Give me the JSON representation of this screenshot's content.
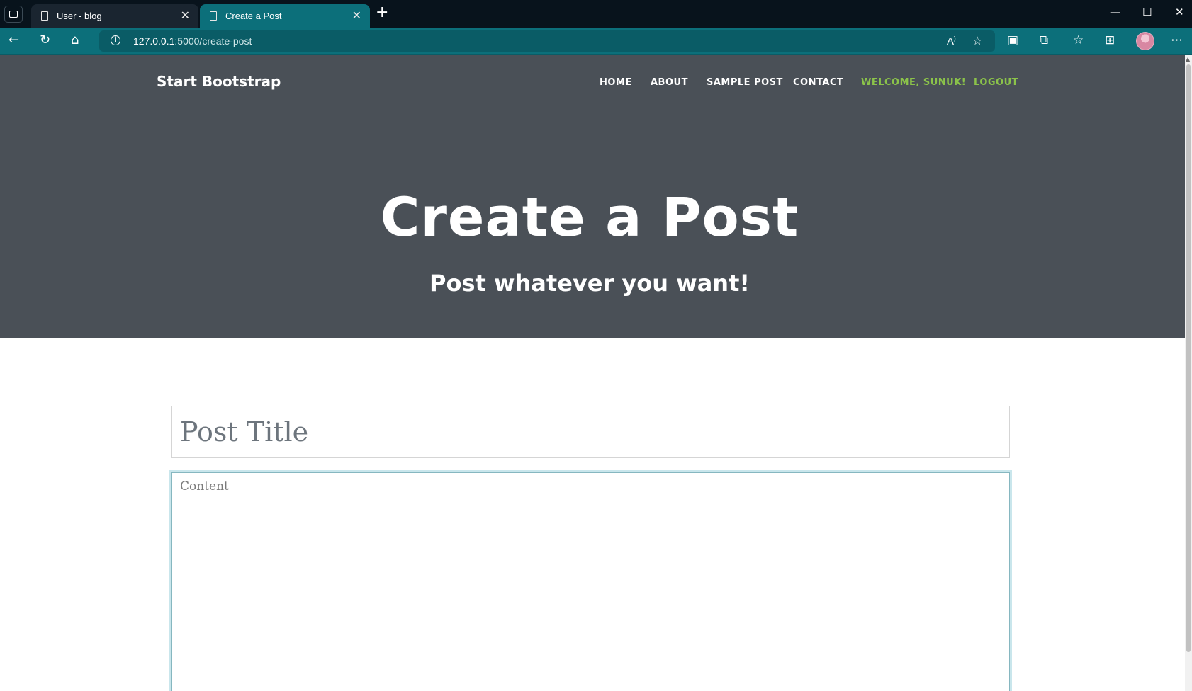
{
  "browser": {
    "tabs": [
      {
        "label": "User - blog",
        "close": "✕"
      },
      {
        "label": "Create a Post",
        "close": "✕"
      }
    ],
    "new_tab": "+",
    "window": {
      "minimize": "—",
      "maximize": "☐",
      "close": "✕"
    },
    "address": {
      "host": "127.0.0.1",
      "rest": ":5000/create-post",
      "info": "i"
    }
  },
  "site": {
    "brand": "Start Bootstrap",
    "nav": [
      {
        "label": "HOME"
      },
      {
        "label": "ABOUT"
      },
      {
        "label": "SAMPLE POST"
      },
      {
        "label": "CONTACT"
      },
      {
        "label": "WELCOME, SUNUK!"
      },
      {
        "label": "LOGOUT"
      }
    ],
    "hero": {
      "title": "Create a Post",
      "subtitle": "Post whatever you want!"
    },
    "form": {
      "title_placeholder": "Post Title",
      "content_placeholder": "Content"
    }
  },
  "colors": {
    "tab_active": "#0c6f7a",
    "masthead": "#4a5057",
    "nav_accent": "#8bc34a"
  }
}
